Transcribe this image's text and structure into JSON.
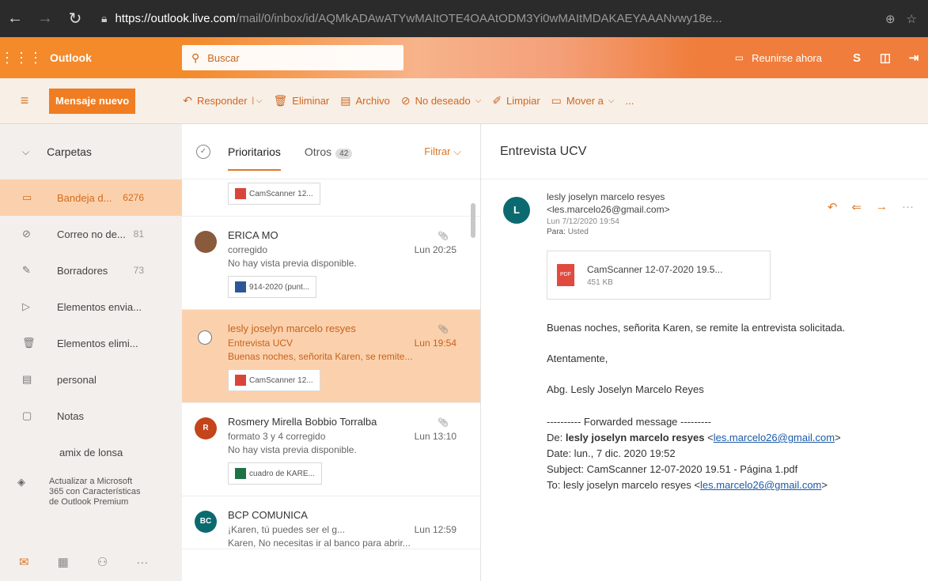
{
  "browser": {
    "url_host": "https://outlook.live.com",
    "url_path": "/mail/0/inbox/id/AQMkADAwATYwMAItOTE4OAAtODM3Yi0wMAItMDAKAEYAAANvwy18e..."
  },
  "header": {
    "brand": "Outlook",
    "search_placeholder": "Buscar",
    "meet_label": "Reunirse ahora"
  },
  "toolbar": {
    "new_message": "Mensaje nuevo",
    "reply": "Responder",
    "delete": "Eliminar",
    "archive": "Archivo",
    "junk": "No deseado",
    "sweep": "Limpiar",
    "move": "Mover a",
    "more": "..."
  },
  "folders": {
    "heading": "Carpetas",
    "items": [
      {
        "label": "Bandeja d...",
        "count": "6276",
        "icon": "inbox-icon"
      },
      {
        "label": "Correo no de...",
        "count": "81",
        "icon": "junk-icon"
      },
      {
        "label": "Borradores",
        "count": "73",
        "icon": "pencil-icon"
      },
      {
        "label": "Elementos envia...",
        "count": "",
        "icon": "send-icon"
      },
      {
        "label": "Elementos elimi...",
        "count": "",
        "icon": "trash-icon"
      },
      {
        "label": "personal",
        "count": "",
        "icon": "folder-icon"
      },
      {
        "label": "Notas",
        "count": "",
        "icon": "note-icon"
      },
      {
        "label": "amix de lonsa",
        "count": "",
        "icon": ""
      }
    ],
    "upsell": "Actualizar a Microsoft 365 con Características de Outlook Premium"
  },
  "list": {
    "tab_focused": "Prioritarios",
    "tab_other": "Otros",
    "other_count": "42",
    "filter": "Filtrar",
    "messages": [
      {
        "attachment": "CamScanner 12..."
      },
      {
        "sender": "ERICA MO",
        "subject": "corregido",
        "date": "Lun 20:25",
        "preview": "No hay vista previa disponible.",
        "attachment": "914-2020 (punt..."
      },
      {
        "sender": "lesly joselyn marcelo resyes",
        "subject": "Entrevista UCV",
        "date": "Lun 19:54",
        "preview": "Buenas noches, señorita Karen, se remite...",
        "attachment": "CamScanner 12..."
      },
      {
        "sender": "Rosmery Mirella Bobbio Torralba",
        "subject": "formato 3 y 4 corregido",
        "date": "Lun 13:10",
        "preview": "No hay vista previa disponible.",
        "attachment": "cuadro de KARE...",
        "avatar": "R"
      },
      {
        "sender": "BCP COMUNICA",
        "subject": "¡Karen, tú puedes ser el g...",
        "date": "Lun 12:59",
        "preview": "Karen, No necesitas ir al banco para abrir...",
        "avatar": "BC"
      }
    ]
  },
  "reading": {
    "subject": "Entrevista UCV",
    "avatar": "L",
    "from": "lesly joselyn marcelo resyes <les.marcelo26@gmail.com>",
    "date": "Lun 7/12/2020 19:54",
    "to_label": "Para:",
    "to": "Usted",
    "attachment_name": "CamScanner 12-07-2020 19.5...",
    "attachment_size": "451 KB",
    "pdf_label": "PDF",
    "body_line1": "Buenas noches, señorita Karen, se remite la entrevista solicitada.",
    "body_line2": "Atentamente,",
    "body_line3": "Abg. Lesly Joselyn Marcelo Reyes",
    "fwd_header": "---------- Forwarded message ---------",
    "fwd_from_label": "De:",
    "fwd_from_name": "lesly joselyn marcelo resyes",
    "fwd_from_email": "les.marcelo26@gmail.com",
    "fwd_date": "Date: lun., 7 dic. 2020 19:52",
    "fwd_subject": "Subject: CamScanner 12-07-2020 19.51 - Página 1.pdf",
    "fwd_to_prefix": "To: lesly joselyn marcelo resyes",
    "fwd_to_email": "les.marcelo26@gmail.com"
  },
  "colors": {
    "accent": "#f07d22",
    "selected": "#fbd1ad",
    "avatar_l": "#0b6a6f"
  }
}
